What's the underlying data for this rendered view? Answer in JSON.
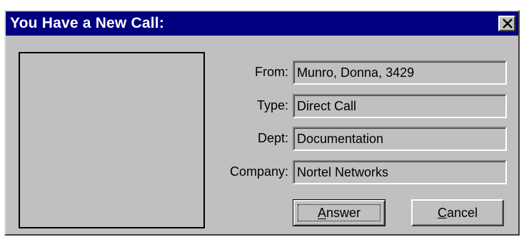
{
  "window": {
    "title": "You Have a New Call:",
    "close_glyph": "×"
  },
  "photo": {
    "icon": "caller-photo-placeholder"
  },
  "fields": [
    {
      "label": "From:",
      "value": "Munro, Donna, 3429"
    },
    {
      "label": "Type:",
      "value": "Direct Call"
    },
    {
      "label": "Dept:",
      "value": "Documentation"
    },
    {
      "label": "Company:",
      "value": "Nortel Networks"
    }
  ],
  "buttons": {
    "answer_label": "Answer",
    "cancel_label": "Cancel"
  },
  "colors": {
    "titlebar": "#000080",
    "face": "#c0c0c0"
  }
}
